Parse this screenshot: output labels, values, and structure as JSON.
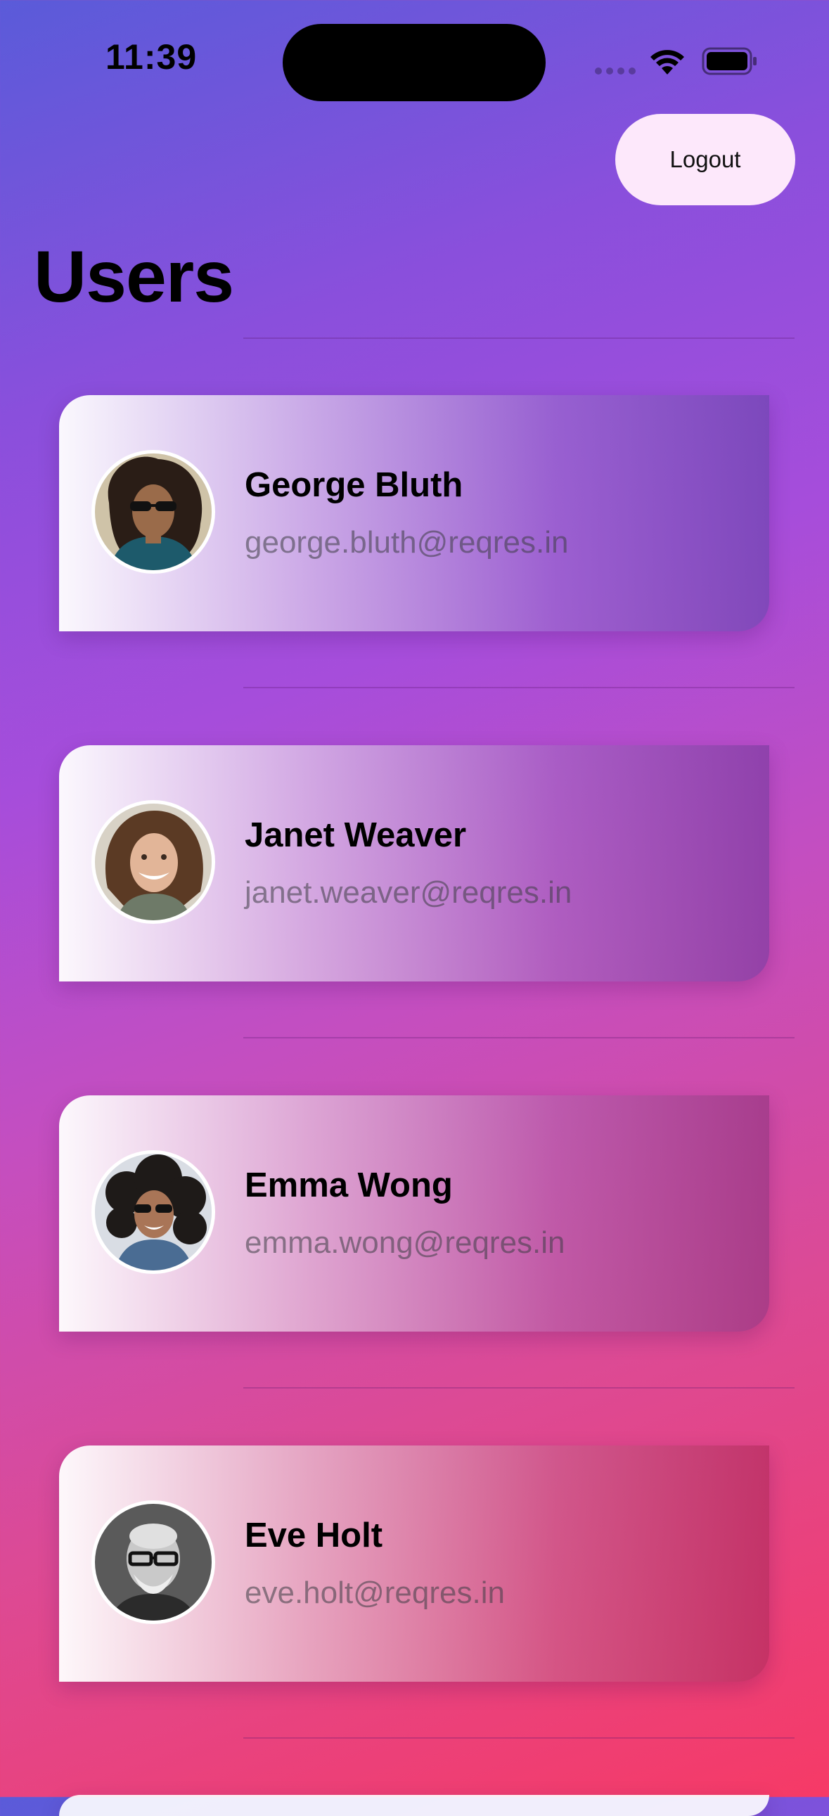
{
  "status_bar": {
    "time": "11:39"
  },
  "header": {
    "logout_label": "Logout",
    "title": "Users"
  },
  "users": [
    {
      "name": "George Bluth",
      "email": "george.bluth@reqres.in"
    },
    {
      "name": "Janet Weaver",
      "email": "janet.weaver@reqres.in"
    },
    {
      "name": "Emma Wong",
      "email": "emma.wong@reqres.in"
    },
    {
      "name": "Eve Holt",
      "email": "eve.holt@reqres.in"
    }
  ],
  "colors": {
    "background_top": "#5a5bd9",
    "background_mid": "#a64ddb",
    "background_bottom": "#f63a66",
    "logout_button": "#fde8fb"
  }
}
